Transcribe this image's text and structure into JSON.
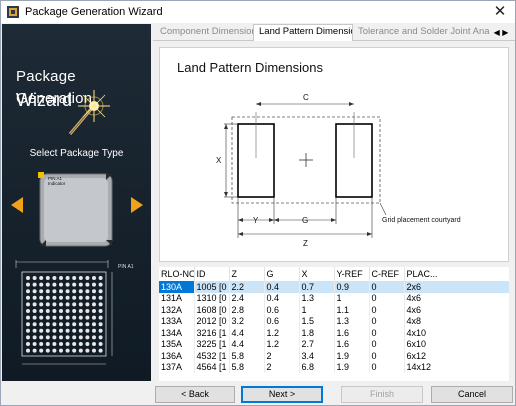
{
  "window": {
    "title": "Package Generation Wizard",
    "close_glyph": "✕"
  },
  "left_panel": {
    "title_line1": "Package Generation",
    "title_line2": "Wizard",
    "select_label": "Select Package Type",
    "pin_label": "PIN A1",
    "indicator_label": "Indicator",
    "pin_label2": "PIN A1"
  },
  "tabs": [
    {
      "label": "Component Dimensions",
      "active": false
    },
    {
      "label": "Land Pattern Dimensions",
      "active": true
    },
    {
      "label": "Tolerance and Solder Joint Analyse",
      "active": false
    }
  ],
  "tab_scroll": {
    "left": "◀",
    "right": "▶"
  },
  "diagram": {
    "heading": "Land Pattern Dimensions",
    "label_c": "C",
    "label_x": "X",
    "label_y": "Y",
    "label_g": "G",
    "label_z": "Z",
    "courtyard_label": "Grid placement courtyard"
  },
  "table": {
    "columns": [
      "RLO-NO",
      "ID",
      "Z",
      "G",
      "X",
      "Y-REF",
      "C-REF",
      "PLAC..."
    ],
    "rows": [
      [
        "130A",
        "1005 [0",
        "2.2",
        "0.4",
        "0.7",
        "0.9",
        "0",
        "2x6"
      ],
      [
        "131A",
        "1310 [0",
        "2.4",
        "0.4",
        "1.3",
        "1",
        "0",
        "4x6"
      ],
      [
        "132A",
        "1608 [0",
        "2.8",
        "0.6",
        "1",
        "1.1",
        "0",
        "4x6"
      ],
      [
        "133A",
        "2012 [0",
        "3.2",
        "0.6",
        "1.5",
        "1.3",
        "0",
        "4x8"
      ],
      [
        "134A",
        "3216 [1",
        "4.4",
        "1.2",
        "1.8",
        "1.6",
        "0",
        "4x10"
      ],
      [
        "135A",
        "3225 [1",
        "4.4",
        "1.2",
        "2.7",
        "1.6",
        "0",
        "6x10"
      ],
      [
        "136A",
        "4532 [1",
        "5.8",
        "2",
        "3.4",
        "1.9",
        "0",
        "6x12"
      ],
      [
        "137A",
        "4564 [1",
        "5.8",
        "2",
        "6.8",
        "1.9",
        "0",
        "14x12"
      ]
    ],
    "selected_row": 0
  },
  "buttons": {
    "back": "< Back",
    "next": "Next >",
    "finish": "Finish",
    "cancel": "Cancel"
  },
  "colors": {
    "accent": "#0078d7",
    "selected_row_bg": "#cce4f7",
    "panel_dark": "#16222d",
    "arrow_orange": "#f0a21b"
  }
}
